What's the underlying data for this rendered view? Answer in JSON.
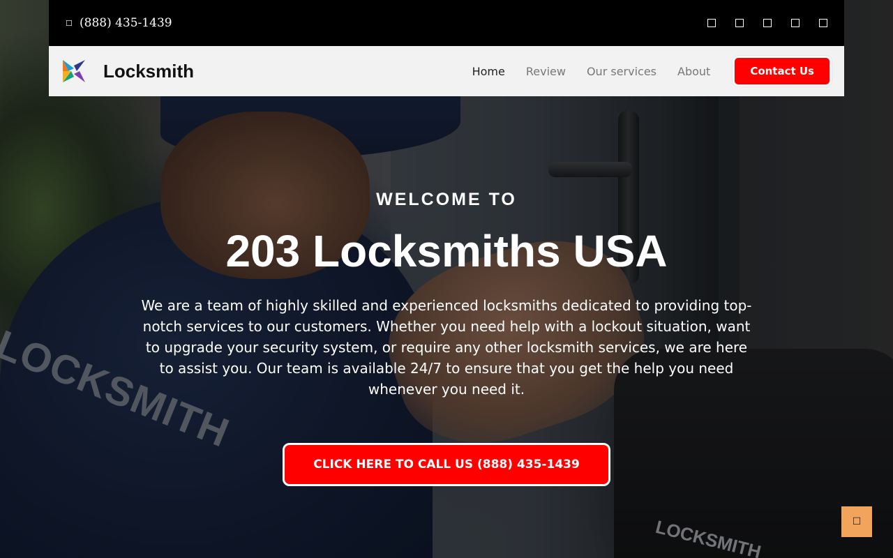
{
  "topbar": {
    "phone_icon": "phone-icon",
    "phone": "(888) 435-1439",
    "socials": [
      "facebook-icon",
      "twitter-icon",
      "instagram-icon",
      "linkedin-icon",
      "youtube-icon"
    ]
  },
  "nav": {
    "brand": "Locksmith",
    "links": [
      "Home",
      "Review",
      "Our services",
      "About"
    ],
    "contact_label": "Contact Us"
  },
  "hero": {
    "welcome": "WELCOME TO",
    "headline": "203 Locksmiths USA",
    "description": "We are a team of highly skilled and experienced locksmiths dedicated to providing top-notch services to our customers. Whether you need help with a lockout situation, want to upgrade your security system, or require any other locksmith services, we are here to assist you. Our team is available 24/7 to ensure that you get the help you need whenever you need it.",
    "cta_label": "CLICK HERE TO CALL US (888) 435-1439",
    "image_text": {
      "shirt": "LOCKSMITH",
      "bag": "LOCKSMITH"
    }
  },
  "colors": {
    "accent": "#ff0000",
    "topbar": "#000000",
    "navbar": "#f2f2f2",
    "scroll_top": "#f2a35c"
  },
  "scroll_top_icon": "arrow-up-icon"
}
